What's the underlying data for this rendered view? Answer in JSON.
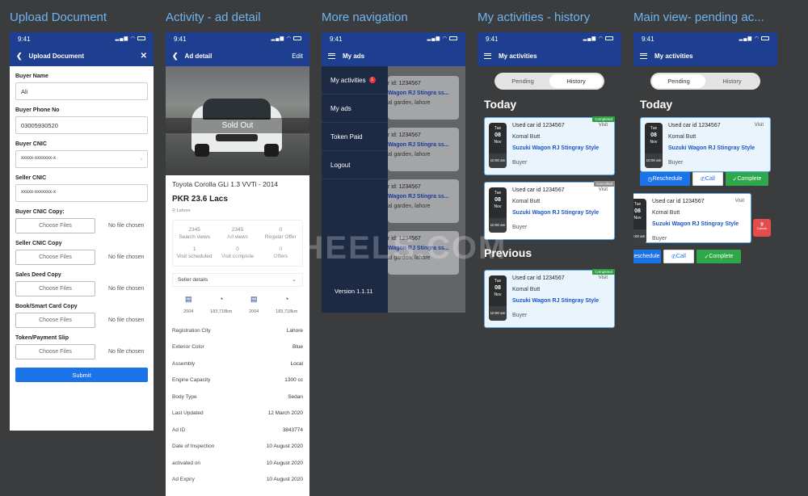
{
  "screens": {
    "upload": {
      "label": "Upload Document"
    },
    "detail": {
      "label": "Activity - ad detail"
    },
    "nav": {
      "label": "More navigation"
    },
    "history": {
      "label": "My activities - history"
    },
    "pending": {
      "label": "Main view- pending ac..."
    }
  },
  "status": {
    "time": "9:41"
  },
  "upload": {
    "title": "Upload Document",
    "buyer_name_label": "Buyer Name",
    "buyer_name": "Ali",
    "buyer_phone_label": "Buyer Phone No",
    "buyer_phone": "03005930520",
    "buyer_cnic_label": "Buyer CNIC",
    "buyer_cnic": "xxxxx-xxxxxxx-x",
    "seller_cnic_label": "Seller CNIC",
    "seller_cnic": "xxxxx-xxxxxxx-x",
    "files": [
      {
        "label": "Buyer CNIC Copy:",
        "button": "Choose Files",
        "status": "No file chosen"
      },
      {
        "label": "Seller CNIC Copy",
        "button": "Choose Files",
        "status": "No file chosen"
      },
      {
        "label": "Sales Deed Copy",
        "button": "Choose Files",
        "status": "No file chosen"
      },
      {
        "label": "Book/Smart Card Copy",
        "button": "Choose Files",
        "status": "No file chosen"
      },
      {
        "label": "Token/Payment Slip",
        "button": "Choose Files",
        "status": "No file chosen"
      }
    ],
    "submit": "Submit"
  },
  "detail": {
    "title": "Ad detail",
    "edit": "Edit",
    "sold": "Sold Out",
    "car": "Toyota Corolla GLi 1.3 VVTi - 2014",
    "price": "PKR 23.6 Lacs",
    "location": "Lahore",
    "stats": [
      {
        "n": "2345",
        "l": "Search views"
      },
      {
        "n": "2345",
        "l": "Ad views"
      },
      {
        "n": "0",
        "l": "Regular Offer"
      },
      {
        "n": "1",
        "l": "Visit scheduled"
      },
      {
        "n": "0",
        "l": "Visit complete"
      },
      {
        "n": "0",
        "l": "Offers"
      }
    ],
    "seller_details": "Seller details",
    "specs": [
      {
        "icon": "calendar-icon",
        "v": "2004"
      },
      {
        "icon": "speedometer-icon",
        "v": "183,718km"
      },
      {
        "icon": "calendar-icon",
        "v": "2004"
      },
      {
        "icon": "speedometer-icon",
        "v": "183,718km"
      }
    ],
    "rows": [
      {
        "k": "Registration City",
        "v": "Lahore"
      },
      {
        "k": "Exterior Color",
        "v": "Blue"
      },
      {
        "k": "Assembly",
        "v": "Local"
      },
      {
        "k": "Engine Capacity",
        "v": "1300 cc"
      },
      {
        "k": "Body Type",
        "v": "Sedan"
      },
      {
        "k": "Last Updated",
        "v": "12 March 2020"
      },
      {
        "k": "Ad ID",
        "v": "3843774"
      },
      {
        "k": "Date of Inspection",
        "v": "10 August 2020"
      },
      {
        "k": "activated on",
        "v": "10 August 2020"
      },
      {
        "k": "Ad Expiry",
        "v": "10 August 2020"
      }
    ]
  },
  "nav": {
    "title": "My ads",
    "items": [
      {
        "label": "My activities",
        "badge": "1"
      },
      {
        "label": "My ads"
      },
      {
        "label": "Token Paid"
      },
      {
        "label": "Logout"
      }
    ],
    "version": "Version 1.1.11",
    "bg_cards": [
      {
        "id": "r id: 1234567",
        "car": "Wagon RJ Stingra ss...",
        "place": "al garden, lahore"
      },
      {
        "id": "r id: 1234567",
        "car": "Wagon RJ Stingra ss...",
        "place": "al garden, lahore"
      },
      {
        "id": "r id: 1234567",
        "car": "Wagon RJ Stingra ss...",
        "place": "al garden, lahore"
      },
      {
        "id": "r id: 1234567",
        "car": "Wagon RJ Stingra ss...",
        "place": "al garden, lahore"
      }
    ]
  },
  "activities": {
    "title": "My activities",
    "tab_pending": "Pending",
    "tab_history": "History",
    "today": "Today",
    "previous": "Previous",
    "card": {
      "id": "Used car id 1234567",
      "name": "Komal Butt",
      "car": "Suzuki Wagon RJ Stingray Style",
      "role": "Buyer",
      "visit": "Visit",
      "day": "Tue",
      "date": "08",
      "month": "Nov",
      "time": "10:00 am"
    },
    "completed": "Completed",
    "cancelled": "Cancelled",
    "reschedule": "Reschedule",
    "call": "Call",
    "complete": "Complete",
    "cancel": "Cancle"
  },
  "watermark": "AKWHEELS.COM",
  "colors": {
    "primary": "#1e3f8f",
    "accent": "#1a73e8",
    "success": "#2ea84a",
    "danger": "#e74c4c"
  }
}
